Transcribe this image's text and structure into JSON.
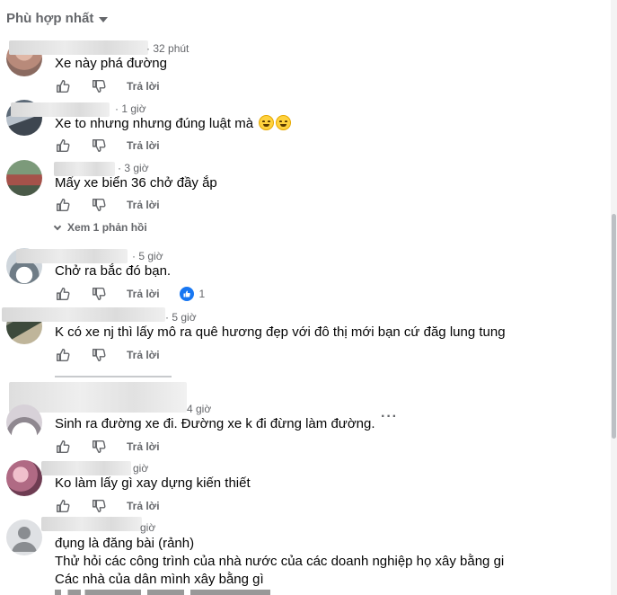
{
  "sort": {
    "label": "Phù hợp nhất"
  },
  "labels": {
    "reply": "Trả lời"
  },
  "comments": [
    {
      "time": "32 phút",
      "text": "Xe này phá đường"
    },
    {
      "time": "1 giờ",
      "text": "Xe to nhưng nhưng đúng luật mà"
    },
    {
      "time": "3 giờ",
      "text": "Mấy xe biển 36 chở đầy ắp",
      "view_replies": "Xem 1 phản hồi"
    },
    {
      "time": "5 giờ",
      "text": "Chở ra bắc đó bạn.",
      "reaction_count": "1"
    },
    {
      "time": "5 giờ",
      "text": "K có xe nj thì lấy mô ra quê hương đẹp với đô thị mới bạn cứ đăg lung tung"
    },
    {
      "time": "4 giờ",
      "text": "Sinh ra đường xe đi. Đường xe k đi đừng làm đường."
    },
    {
      "time": "giờ",
      "text": "Ko làm lấy gì xay dựng kiến thiết"
    },
    {
      "time": "giờ",
      "lines": [
        "đụng là đăng bài (rảnh)",
        "Thử hỏi các công trình của nhà nước của các doanh nghiệp họ xây bằng gi",
        "Các nhà của dân mình xây bằng gì"
      ]
    }
  ],
  "icons": {
    "like": "thumbs-up-icon",
    "dislike": "thumbs-down-icon",
    "reaction": "like-reaction-icon",
    "more": "more-options-icon",
    "sort": "chevron-down-icon"
  },
  "colors": {
    "secondary_text": "#65676b",
    "text": "#050505",
    "reaction_blue": "#1877f2"
  }
}
